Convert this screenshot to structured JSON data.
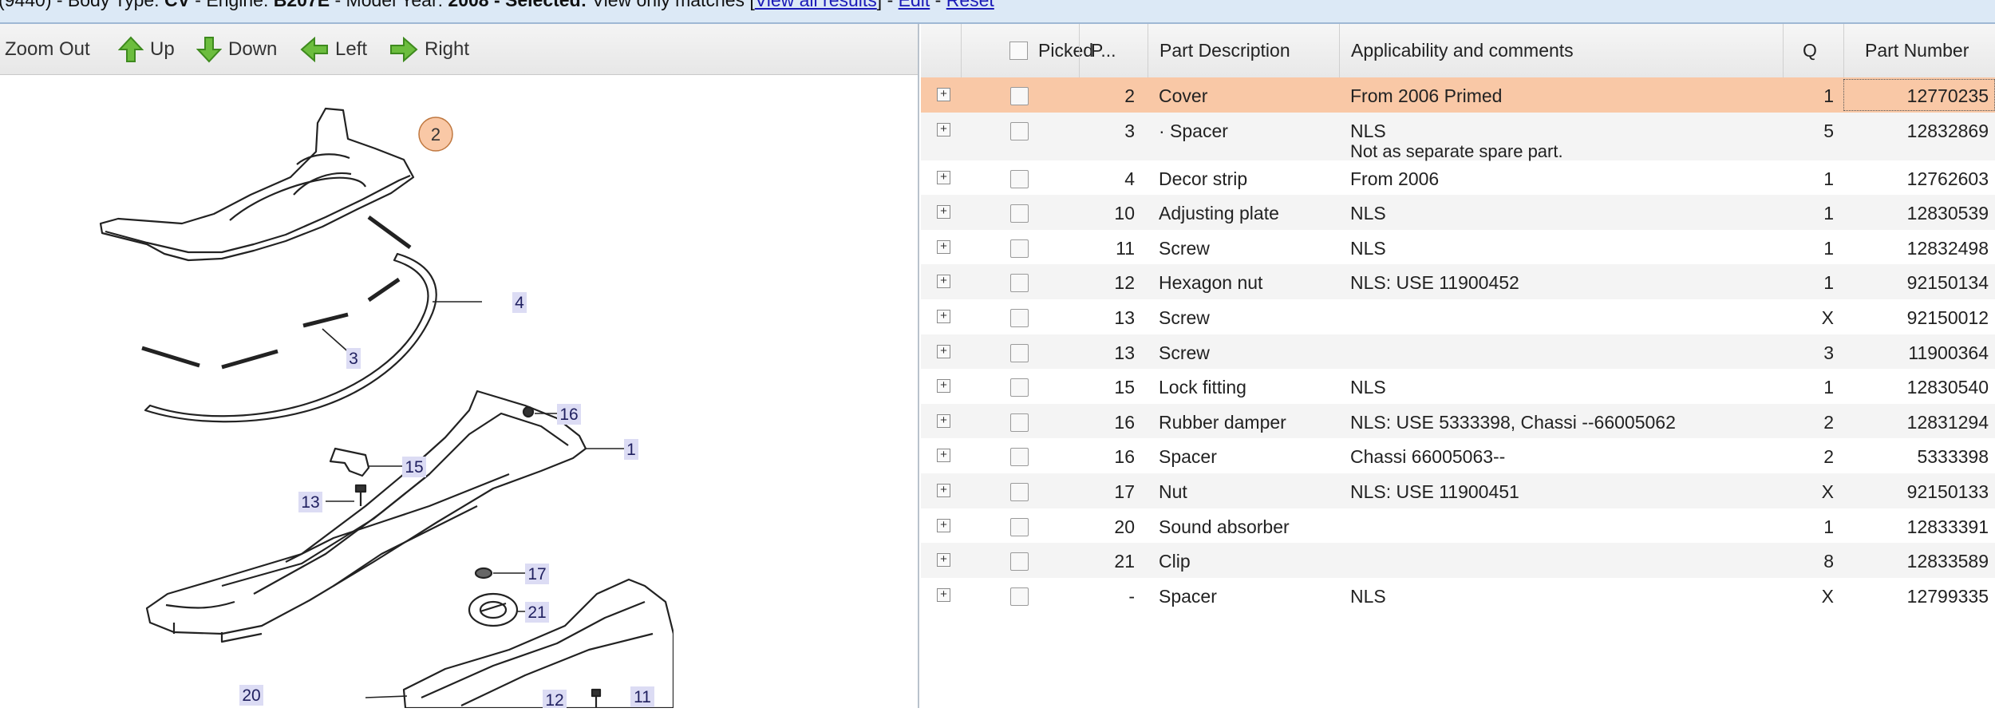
{
  "topbar": {
    "prefix": "(9440) - Body Type: ",
    "body_type": "CV",
    "engine_label": " - Engine: ",
    "engine": "B207E",
    "year_label": " - Model Year: ",
    "year": "2008",
    "selected_label": " - Selected: ",
    "selected_text": "View only matches [",
    "view_all": "View all results",
    "sep1": "] - ",
    "edit": "Edit",
    "sep2": " - ",
    "reset": "Reset"
  },
  "toolbar": {
    "zoom_out": "Zoom Out",
    "up": "Up",
    "down": "Down",
    "left": "Left",
    "right": "Right"
  },
  "drawing": {
    "callouts": [
      "2",
      "3",
      "4",
      "16",
      "15",
      "1",
      "13",
      "17",
      "21",
      "20",
      "12",
      "11"
    ]
  },
  "table": {
    "headers": {
      "picked": "Picked",
      "pos": "P...",
      "description": "Part Description",
      "applicability": "Applicability and comments",
      "qty": "Q",
      "part_number": "Part Number"
    },
    "rows": [
      {
        "pos": "2",
        "desc": "Cover",
        "comment": "From 2006 Primed",
        "comment2": "",
        "qty": "1",
        "pn": "12770235"
      },
      {
        "pos": "3",
        "desc": "· Spacer",
        "comment": "NLS",
        "comment2": "Not as separate spare part.",
        "qty": "5",
        "pn": "12832869"
      },
      {
        "pos": "4",
        "desc": "Decor strip",
        "comment": "From 2006",
        "comment2": "",
        "qty": "1",
        "pn": "12762603"
      },
      {
        "pos": "10",
        "desc": "Adjusting plate",
        "comment": "NLS",
        "comment2": "",
        "qty": "1",
        "pn": "12830539"
      },
      {
        "pos": "11",
        "desc": "Screw",
        "comment": "NLS",
        "comment2": "",
        "qty": "1",
        "pn": "12832498"
      },
      {
        "pos": "12",
        "desc": "Hexagon nut",
        "comment": "NLS: USE 11900452",
        "comment2": "",
        "qty": "1",
        "pn": "92150134"
      },
      {
        "pos": "13",
        "desc": "Screw",
        "comment": "",
        "comment2": "",
        "qty": "X",
        "pn": "92150012"
      },
      {
        "pos": "13",
        "desc": "Screw",
        "comment": "",
        "comment2": "",
        "qty": "3",
        "pn": "11900364"
      },
      {
        "pos": "15",
        "desc": "Lock fitting",
        "comment": "NLS",
        "comment2": "",
        "qty": "1",
        "pn": "12830540"
      },
      {
        "pos": "16",
        "desc": "Rubber damper",
        "comment": "NLS: USE 5333398, Chassi --66005062",
        "comment2": "",
        "qty": "2",
        "pn": "12831294"
      },
      {
        "pos": "16",
        "desc": "Spacer",
        "comment": "Chassi 66005063--",
        "comment2": "",
        "qty": "2",
        "pn": "5333398"
      },
      {
        "pos": "17",
        "desc": "Nut",
        "comment": "NLS: USE 11900451",
        "comment2": "",
        "qty": "X",
        "pn": "92150133"
      },
      {
        "pos": "20",
        "desc": "Sound absorber",
        "comment": "",
        "comment2": "",
        "qty": "1",
        "pn": "12833391"
      },
      {
        "pos": "21",
        "desc": "Clip",
        "comment": "",
        "comment2": "",
        "qty": "8",
        "pn": "12833589"
      },
      {
        "pos": "-",
        "desc": "Spacer",
        "comment": "NLS",
        "comment2": "",
        "qty": "X",
        "pn": "12799335"
      }
    ]
  },
  "colors": {
    "selected_row": "#f9c8a6",
    "topbar_bg": "#dce9f6",
    "callout_bg": "#dcdcf4",
    "highlight_callout": "#f9c8a6",
    "toolbar_arrow": "#5aa832"
  }
}
